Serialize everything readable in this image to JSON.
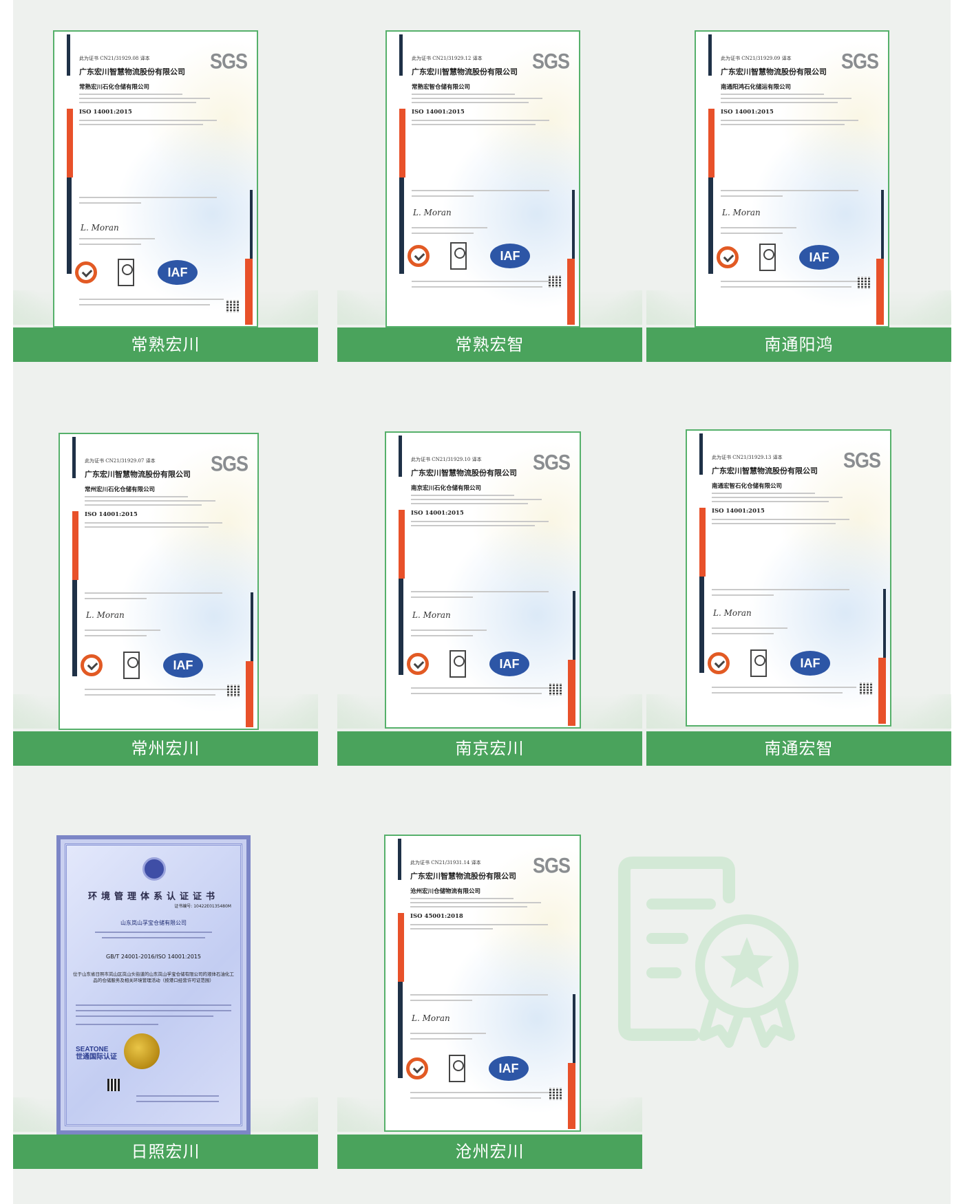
{
  "cards": [
    {
      "label": "常熟宏川",
      "cert_ref": "此为证书 CN21/31929.08 译本",
      "holder": "广东宏川智慧物流股份有限公司",
      "site": "常熟宏川石化仓储有限公司",
      "standard": "ISO 14001:2015",
      "signature": "L. Moran"
    },
    {
      "label": "常熟宏智",
      "cert_ref": "此为证书 CN21/31929.12 译本",
      "holder": "广东宏川智慧物流股份有限公司",
      "site": "常熟宏智仓储有限公司",
      "standard": "ISO 14001:2015",
      "signature": "L. Moran"
    },
    {
      "label": "南通阳鸿",
      "cert_ref": "此为证书 CN21/31929.09 译本",
      "holder": "广东宏川智慧物流股份有限公司",
      "site": "南通阳鸿石化储运有限公司",
      "standard": "ISO 14001:2015",
      "signature": "L. Moran"
    },
    {
      "label": "常州宏川",
      "cert_ref": "此为证书 CN21/31929.07 译本",
      "holder": "广东宏川智慧物流股份有限公司",
      "site": "常州宏川石化仓储有限公司",
      "standard": "ISO 14001:2015",
      "signature": "L. Moran"
    },
    {
      "label": "南京宏川",
      "cert_ref": "此为证书 CN21/31929.10 译本",
      "holder": "广东宏川智慧物流股份有限公司",
      "site": "南京宏川石化仓储有限公司",
      "standard": "ISO 14001:2015",
      "signature": "L. Moran"
    },
    {
      "label": "南通宏智",
      "cert_ref": "此为证书 CN21/31929.13 译本",
      "holder": "广东宏川智慧物流股份有限公司",
      "site": "南通宏智石化仓储有限公司",
      "standard": "ISO 14001:2015",
      "signature": "L. Moran"
    },
    {
      "label": "日照宏川",
      "title": "环境管理体系认证证书",
      "cert_no": "证书编号: 10422E0135480M",
      "holder": "山东岚山孚宝仓储有限公司",
      "standard": "GB/T 24001-2016/ISO 14001:2015",
      "scope": "位于山东省日照市岚山区岚山头街道的山东岚山孚宝仓储有限公司的液体石油化工品的仓储服务及相关环境管理活动（按港口经营许可证范围）",
      "brand_en": "SEATONE",
      "brand_cn": "世通国际认证"
    },
    {
      "label": "沧州宏川",
      "cert_ref": "此为证书 CN21/31931.14 译本",
      "holder": "广东宏川智慧物流股份有限公司",
      "site": "沧州宏川仓储物流有限公司",
      "standard": "ISO 45001:2018",
      "signature": "L. Moran"
    }
  ],
  "brand_mark": "SGS",
  "iaf_mark": "IAF",
  "colors": {
    "label_green": "#4aa35c",
    "cert_accent": "#e8512a",
    "cert_navy": "#1f3147",
    "placeholder_green": "#d3e9d6"
  },
  "placeholder_icon": "certificate-award-icon"
}
